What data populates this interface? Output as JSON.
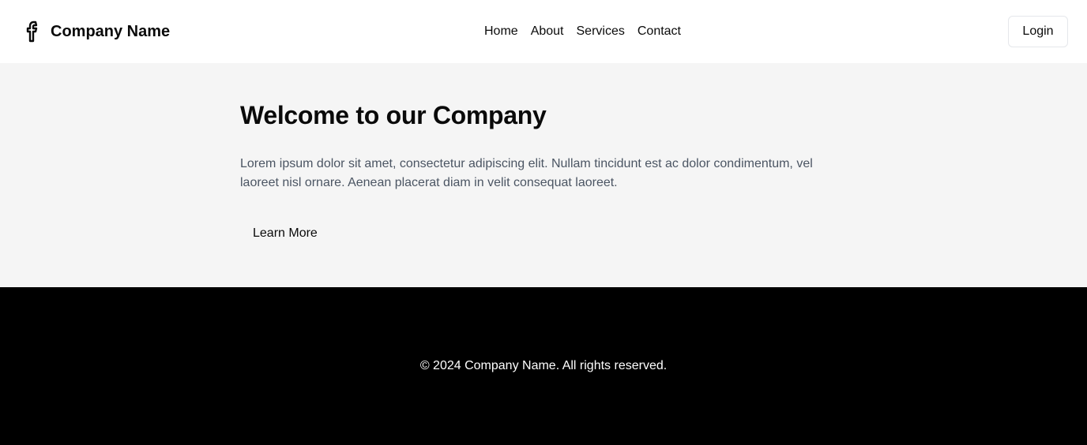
{
  "header": {
    "brand_name": "Company Name",
    "brand_icon": "facebook-icon",
    "nav": [
      {
        "label": "Home"
      },
      {
        "label": "About"
      },
      {
        "label": "Services"
      },
      {
        "label": "Contact"
      }
    ],
    "login_label": "Login"
  },
  "hero": {
    "title": "Welcome to our Company",
    "body": "Lorem ipsum dolor sit amet, consectetur adipiscing elit. Nullam tincidunt est ac dolor condimentum, vel laoreet nisl ornare. Aenean placerat diam in velit consequat laoreet.",
    "cta_label": "Learn More"
  },
  "footer": {
    "copyright": "© 2024 Company Name. All rights reserved."
  },
  "colors": {
    "header_bg": "#ffffff",
    "hero_bg": "#f5f5f5",
    "footer_bg": "#000000",
    "text_primary": "#0a0a0a",
    "text_muted": "#4b5563",
    "border": "#e5e7eb"
  }
}
